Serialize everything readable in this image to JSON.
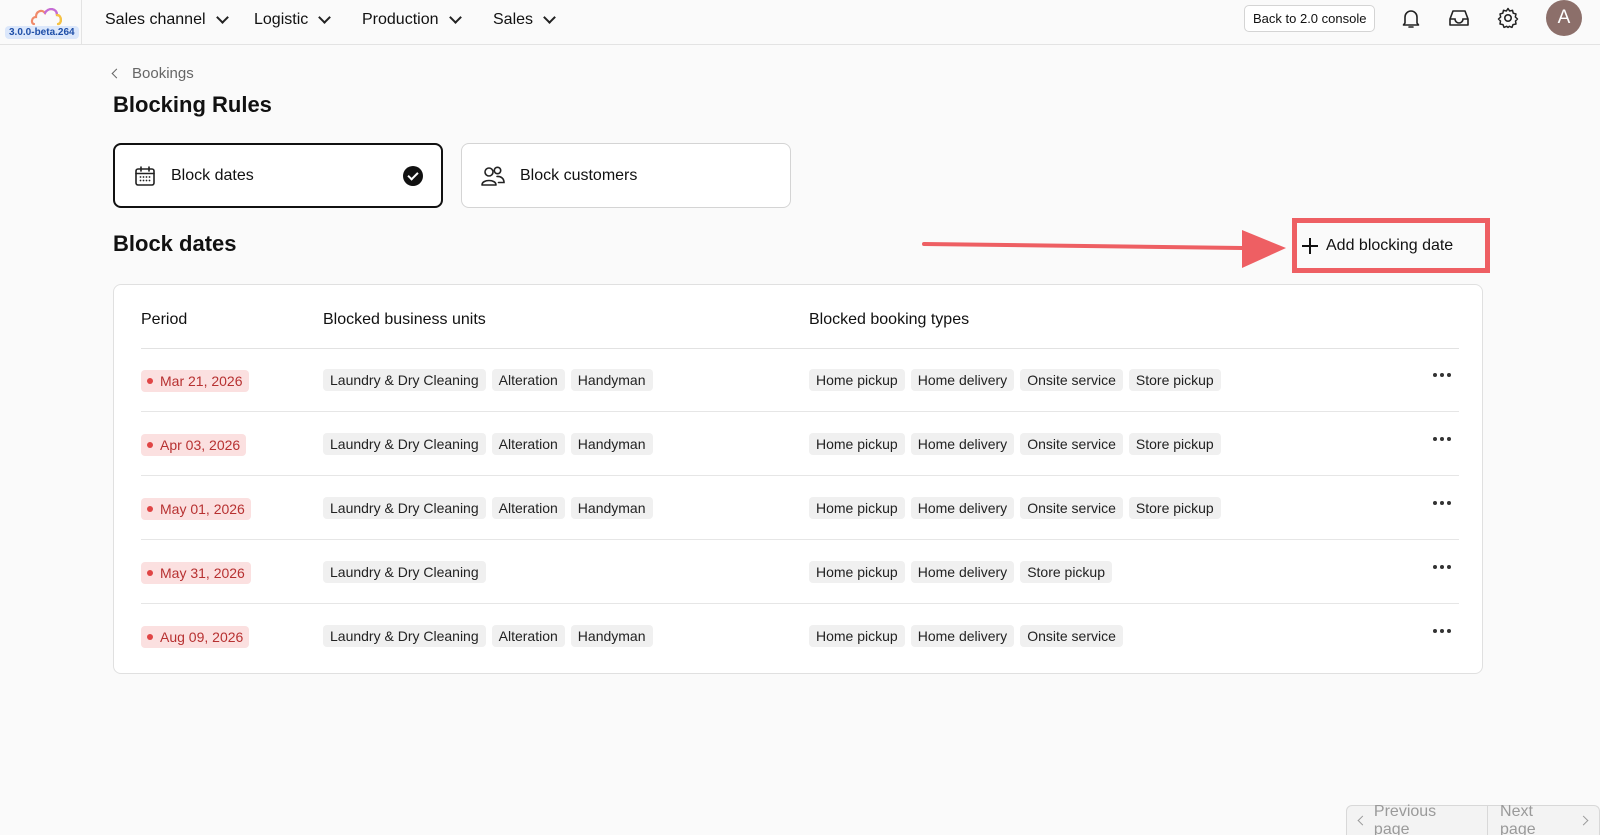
{
  "header": {
    "version": "3.0.0-beta.264",
    "nav": [
      {
        "label": "Sales channel"
      },
      {
        "label": "Logistic"
      },
      {
        "label": "Production"
      },
      {
        "label": "Sales"
      }
    ],
    "console_button": "Back to 2.0 console",
    "avatar_initial": "A",
    "icons": [
      "bell-icon",
      "inbox-icon",
      "gear-icon"
    ]
  },
  "breadcrumb": {
    "back_label": "Bookings"
  },
  "page": {
    "title": "Blocking Rules",
    "options": [
      {
        "label": "Block dates",
        "selected": true,
        "icon": "calendar-icon"
      },
      {
        "label": "Block customers",
        "selected": false,
        "icon": "users-icon"
      }
    ],
    "section_title": "Block dates",
    "add_button": "Add blocking date",
    "annotation_color": "#ee5f63"
  },
  "table": {
    "columns": [
      "Period",
      "Blocked business units",
      "Blocked booking types"
    ],
    "rows": [
      {
        "date": "Mar 21, 2026",
        "units": [
          "Laundry & Dry Cleaning",
          "Alteration",
          "Handyman"
        ],
        "types": [
          "Home pickup",
          "Home delivery",
          "Onsite service",
          "Store pickup"
        ]
      },
      {
        "date": "Apr 03, 2026",
        "units": [
          "Laundry & Dry Cleaning",
          "Alteration",
          "Handyman"
        ],
        "types": [
          "Home pickup",
          "Home delivery",
          "Onsite service",
          "Store pickup"
        ]
      },
      {
        "date": "May 01, 2026",
        "units": [
          "Laundry & Dry Cleaning",
          "Alteration",
          "Handyman"
        ],
        "types": [
          "Home pickup",
          "Home delivery",
          "Onsite service",
          "Store pickup"
        ]
      },
      {
        "date": "May 31, 2026",
        "units": [
          "Laundry & Dry Cleaning"
        ],
        "types": [
          "Home pickup",
          "Home delivery",
          "Store pickup"
        ]
      },
      {
        "date": "Aug 09, 2026",
        "units": [
          "Laundry & Dry Cleaning",
          "Alteration",
          "Handyman"
        ],
        "types": [
          "Home pickup",
          "Home delivery",
          "Onsite service"
        ]
      }
    ]
  },
  "pagination": {
    "previous": "Previous page",
    "next": "Next page"
  }
}
